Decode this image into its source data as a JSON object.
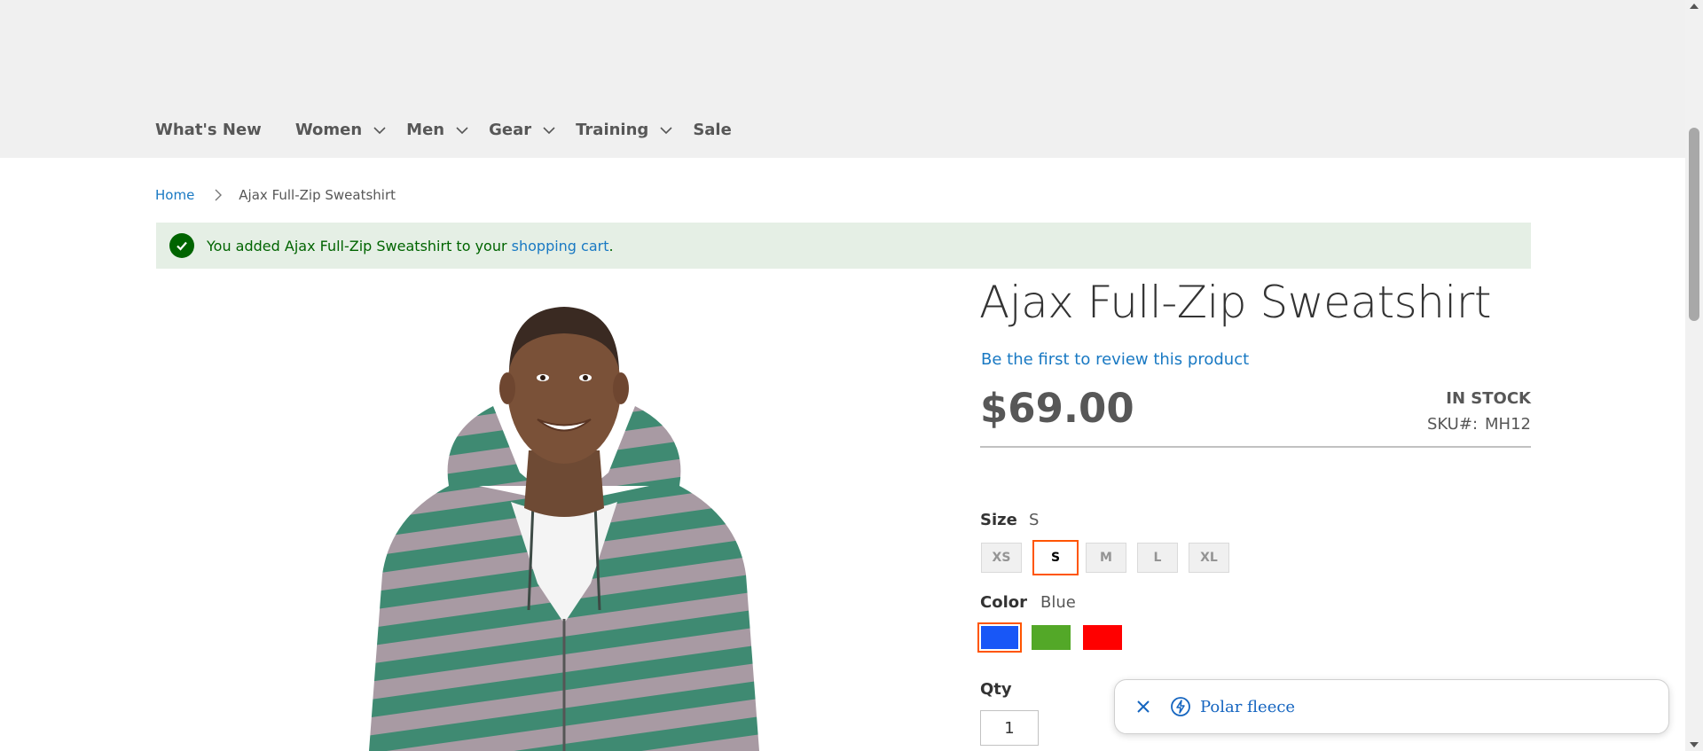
{
  "nav": {
    "items": [
      {
        "label": "What's New",
        "has_dropdown": false
      },
      {
        "label": "Women",
        "has_dropdown": true
      },
      {
        "label": "Men",
        "has_dropdown": true
      },
      {
        "label": "Gear",
        "has_dropdown": true
      },
      {
        "label": "Training",
        "has_dropdown": true
      },
      {
        "label": "Sale",
        "has_dropdown": false
      }
    ]
  },
  "breadcrumb": {
    "home": "Home",
    "current": "Ajax Full-Zip Sweatshirt"
  },
  "message": {
    "prefix": "You added Ajax Full-Zip Sweatshirt to your ",
    "link": "shopping cart",
    "suffix": "."
  },
  "product": {
    "title": "Ajax Full-Zip Sweatshirt",
    "review_link": "Be the first to review this product",
    "price": "$69.00",
    "stock": "IN STOCK",
    "sku_label": "SKU#:",
    "sku_value": "MH12"
  },
  "options": {
    "size_label": "Size",
    "size_selected": "S",
    "sizes": [
      "XS",
      "S",
      "M",
      "L",
      "XL"
    ],
    "color_label": "Color",
    "color_selected": "Blue",
    "colors": [
      {
        "name": "Blue",
        "hex": "#1857f7"
      },
      {
        "name": "Green",
        "hex": "#53a828"
      },
      {
        "name": "Red",
        "hex": "#ff0000"
      }
    ]
  },
  "qty": {
    "label": "Qty",
    "value": "1"
  },
  "toast": {
    "text": "Polar fleece"
  },
  "colors": {
    "header_bg": "#f0f0f0",
    "link": "#1979c3",
    "success_bg": "#e5efe5",
    "success_text": "#006400",
    "selected_border": "#ff5501"
  }
}
